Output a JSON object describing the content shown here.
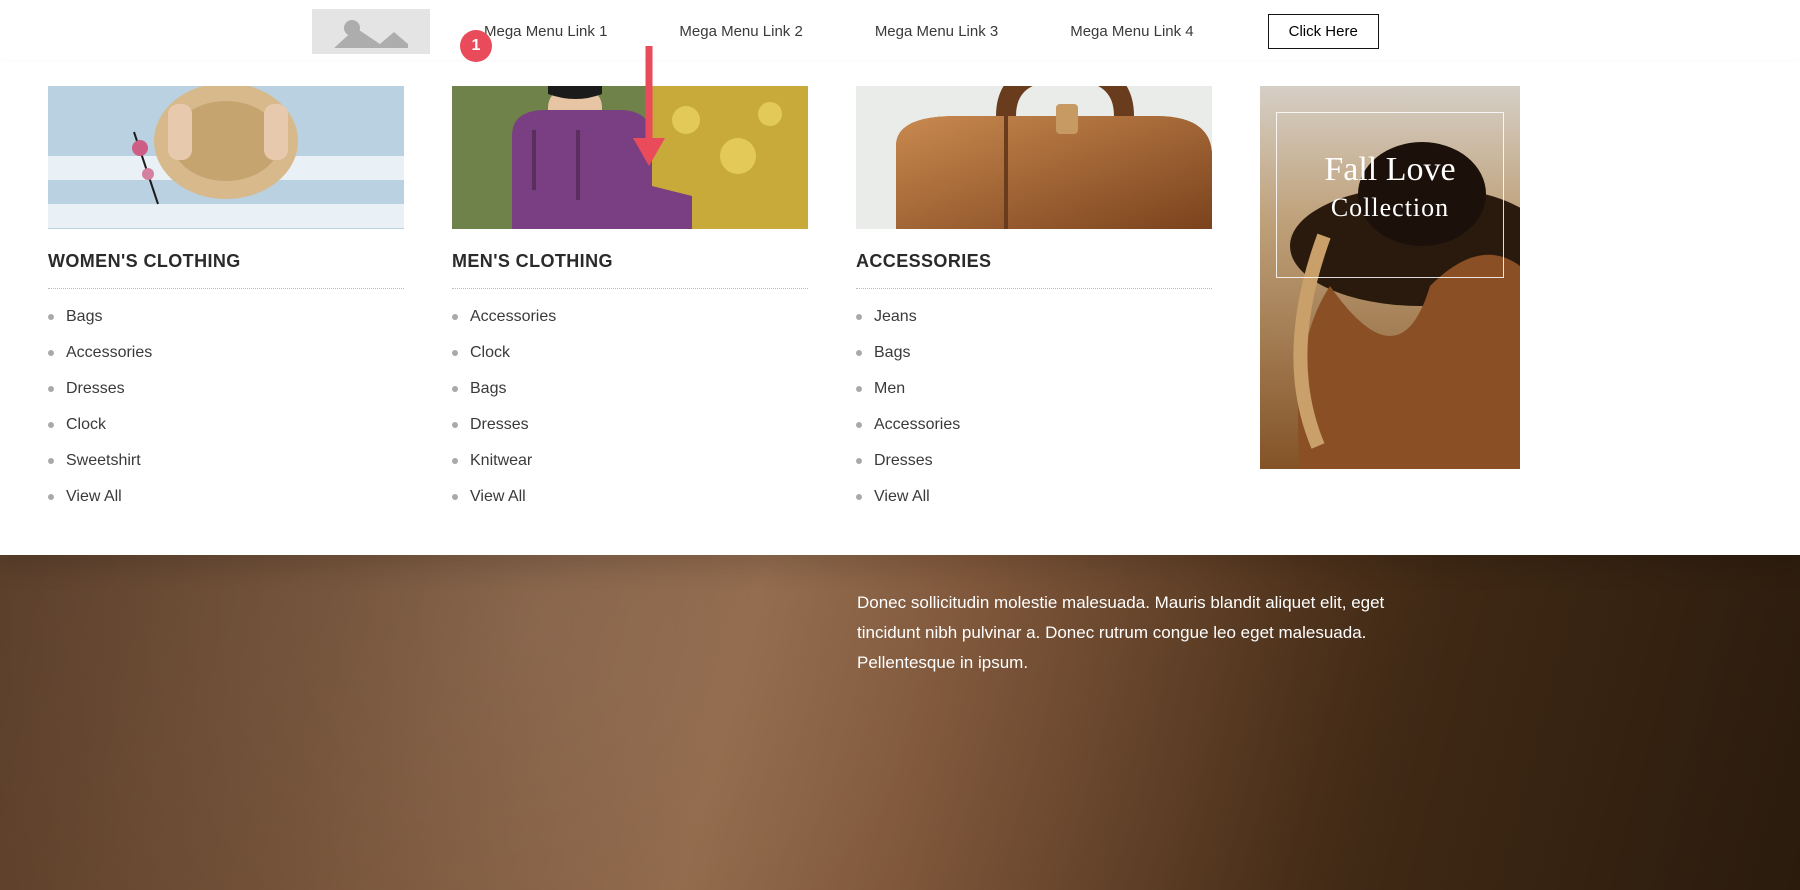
{
  "annotation": {
    "badge": "1"
  },
  "nav": {
    "links": [
      "Mega Menu Link 1",
      "Mega Menu Link 2",
      "Mega Menu Link 3",
      "Mega Menu Link 4"
    ],
    "cta": "Click Here"
  },
  "hero": {
    "paragraph": "Donec sollicitudin molestie malesuada. Mauris blandit aliquet elit, eget tincidunt nibh pulvinar a. Donec rutrum congue leo eget malesuada. Pellentesque in ipsum."
  },
  "mega": {
    "columns": [
      {
        "title": "WOMEN'S CLOTHING",
        "items": [
          "Bags",
          "Accessories",
          "Dresses",
          "Clock",
          "Sweetshirt",
          "View All"
        ]
      },
      {
        "title": "MEN'S CLOTHING",
        "items": [
          "Accessories",
          "Clock",
          "Bags",
          "Dresses",
          "Knitwear",
          "View All"
        ]
      },
      {
        "title": "ACCESSORIES",
        "items": [
          "Jeans",
          "Bags",
          "Men",
          "Accessories",
          "Dresses",
          "View All"
        ]
      }
    ],
    "promo": {
      "line1": "Fall Love",
      "line2": "Collection"
    }
  }
}
